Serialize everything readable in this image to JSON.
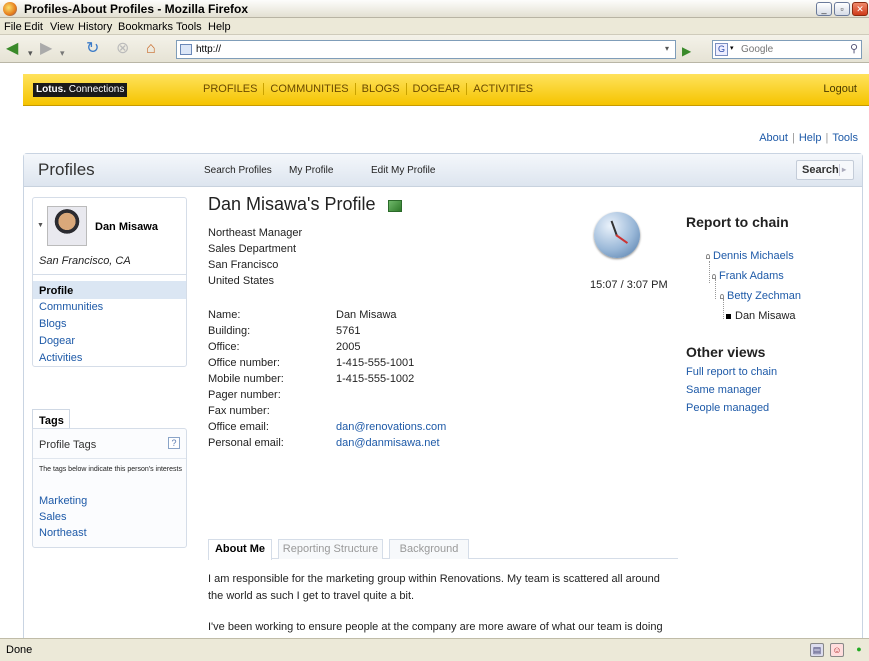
{
  "window": {
    "title": "Profiles-About Profiles - Mozilla Firefox"
  },
  "menu": [
    "File",
    "Edit",
    "View",
    "History",
    "Bookmarks",
    "Tools",
    "Help"
  ],
  "navbar": {
    "url": "http://",
    "search_placeholder": "Google",
    "search_engine": "G"
  },
  "app": {
    "brand_lotus": "Lotus.",
    "brand_connections": "Connections",
    "tabs": [
      "PROFILES",
      "COMMUNITIES",
      "BLOGS",
      "DOGEAR",
      "ACTIVITIES"
    ],
    "logout": "Logout",
    "top_links": [
      "About",
      "Help",
      "Tools"
    ]
  },
  "profiles_header": {
    "title": "Profiles",
    "nav": [
      "Search Profiles",
      "My Profile",
      "Edit My Profile"
    ],
    "search_button": "Search"
  },
  "left": {
    "name": "Dan Misawa",
    "location": "San Francisco, CA",
    "selected": "Profile",
    "links": [
      "Communities",
      "Blogs",
      "Dogear",
      "Activities"
    ]
  },
  "tags": {
    "tab": "Tags",
    "panel_title": "Profile Tags",
    "help": "?",
    "note": "The tags below indicate this person's interests",
    "items": [
      "Marketing",
      "Sales",
      "Northeast"
    ]
  },
  "profile": {
    "heading": "Dan Misawa's Profile",
    "summary": [
      "Northeast Manager",
      "Sales Department",
      "San Francisco",
      "United States"
    ],
    "local_time": "15:07 / 3:07 PM",
    "fields": [
      {
        "label": "Name:",
        "value": "Dan Misawa"
      },
      {
        "label": "Building:",
        "value": "5761"
      },
      {
        "label": "Office:",
        "value": "2005"
      },
      {
        "label": "Office number:",
        "value": "1-415-555-1001"
      },
      {
        "label": "Mobile number:",
        "value": "1-415-555-1002"
      },
      {
        "label": "Pager number:",
        "value": ""
      },
      {
        "label": "Fax number:",
        "value": ""
      },
      {
        "label": "Office email:",
        "value": "dan@renovations.com"
      },
      {
        "label": "Personal email:",
        "value": "dan@danmisawa.net"
      }
    ],
    "tabs": [
      "About Me",
      "Reporting Structure",
      "Background"
    ],
    "about": [
      "I am responsible for the marketing group within Renovations. My team is scattered all around the world as such I get to travel quite a bit.",
      "I've been working to ensure people at the company are more aware of what our team is doing therefore we hope that you visit our new location off the Intranet site -- renovations.com/marketing. Feel free to add any comments at the site if there is more you think our team can provide in the marketing area."
    ]
  },
  "right": {
    "report_heading": "Report to chain",
    "chain": [
      "Dennis Michaels",
      "Frank Adams",
      "Betty Zechman",
      "Dan Misawa"
    ],
    "other_heading": "Other views",
    "other_links": [
      "Full report to chain",
      "Same manager",
      "People managed"
    ]
  },
  "status": {
    "text": "Done"
  }
}
